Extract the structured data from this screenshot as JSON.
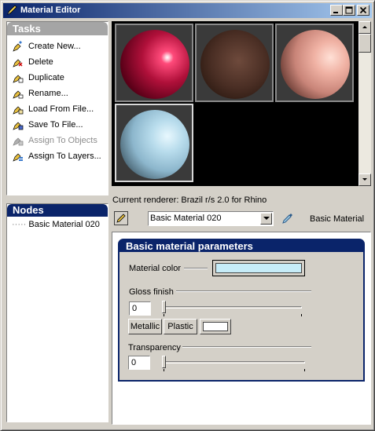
{
  "window": {
    "title": "Material Editor",
    "icon": "pencil-icon"
  },
  "titlebar_buttons": [
    "minimize-icon",
    "maximize-icon",
    "close-icon"
  ],
  "tasks": {
    "header": "Tasks",
    "items": [
      {
        "label": "Create New...",
        "icon": "create-new-icon",
        "enabled": true
      },
      {
        "label": "Delete",
        "icon": "delete-icon",
        "enabled": true
      },
      {
        "label": "Duplicate",
        "icon": "duplicate-icon",
        "enabled": true
      },
      {
        "label": "Rename...",
        "icon": "rename-icon",
        "enabled": true
      },
      {
        "label": "Load From File...",
        "icon": "load-file-icon",
        "enabled": true
      },
      {
        "label": "Save To File...",
        "icon": "save-file-icon",
        "enabled": true
      },
      {
        "label": "Assign To Objects",
        "icon": "assign-objects-icon",
        "enabled": false
      },
      {
        "label": "Assign To Layers...",
        "icon": "assign-layers-icon",
        "enabled": true
      }
    ]
  },
  "nodes": {
    "header": "Nodes",
    "items": [
      "Basic Material 020"
    ]
  },
  "swatches": [
    {
      "name": "red-glossy",
      "base": "#b0103a",
      "light": "#ff4a7a",
      "dark": "#300010"
    },
    {
      "name": "brown-dark",
      "base": "#4a2e24",
      "light": "#6e4a3c",
      "dark": "#1c0f0a"
    },
    {
      "name": "pink-matte",
      "base": "#d8978a",
      "light": "#ffd8cc",
      "dark": "#2a1410"
    },
    {
      "name": "light-blue",
      "base": "#9fc8de",
      "light": "#e0f4fc",
      "dark": "#1a2a34"
    }
  ],
  "renderer": {
    "text": "Current renderer: Brazil r/s 2.0 for Rhino"
  },
  "material_select": {
    "value": "Basic Material 020",
    "type_label": "Basic Material"
  },
  "params": {
    "header": "Basic material parameters",
    "material_color_label": "Material color",
    "material_color": "#c6ecf8",
    "gloss_label": "Gloss finish",
    "gloss_value": "0",
    "metallic_label": "Metallic",
    "plastic_label": "Plastic",
    "gloss_color": "#ffffff",
    "transparency_label": "Transparency",
    "transparency_value": "0"
  }
}
